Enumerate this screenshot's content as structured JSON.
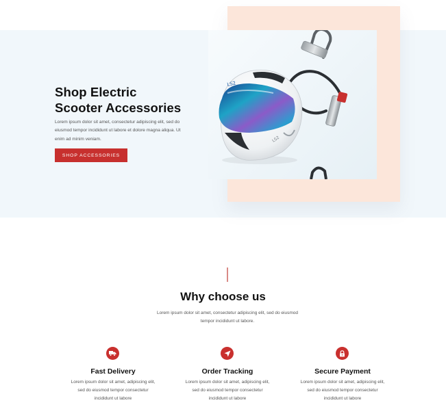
{
  "hero": {
    "title_line1": "Shop Electric",
    "title_line2": "Scooter Accessories",
    "description": "Lorem ipsum dolor sit amet, consectetur adipiscing elit, sed do eiusmod tempor incididunt ut labore et dolore magna aliqua. Ut enim ad minim veniam.",
    "button_label": "SHOP ACCESSORIES",
    "image_subject": "white motorcycle helmet with iridescent visor and bike locks"
  },
  "why": {
    "title": "Why choose us",
    "description": "Lorem ipsum dolor sit amet, consectetur adipiscing elit, sed do eiusmod tempor incididunt ut labore."
  },
  "features": [
    {
      "icon": "truck-icon",
      "title": "Fast Delivery",
      "description": "Lorem ipsum dolor sit amet, adipiscing elit, sed do eiusmod tempor consectetur incididunt ut labore"
    },
    {
      "icon": "navigation-arrow-icon",
      "title": "Order Tracking",
      "description": "Lorem ipsum dolor sit amet, adipiscing elit, sed do eiusmod tempor consectetur incididunt ut labore"
    },
    {
      "icon": "lock-icon",
      "title": "Secure Payment",
      "description": "Lorem ipsum dolor sit amet, adipiscing elit, sed do eiusmod tempor consectetur incididunt ut labore"
    }
  ],
  "colors": {
    "accent": "#c7302e",
    "hero_background": "#f1f7fb",
    "frame": "#fce6da"
  }
}
